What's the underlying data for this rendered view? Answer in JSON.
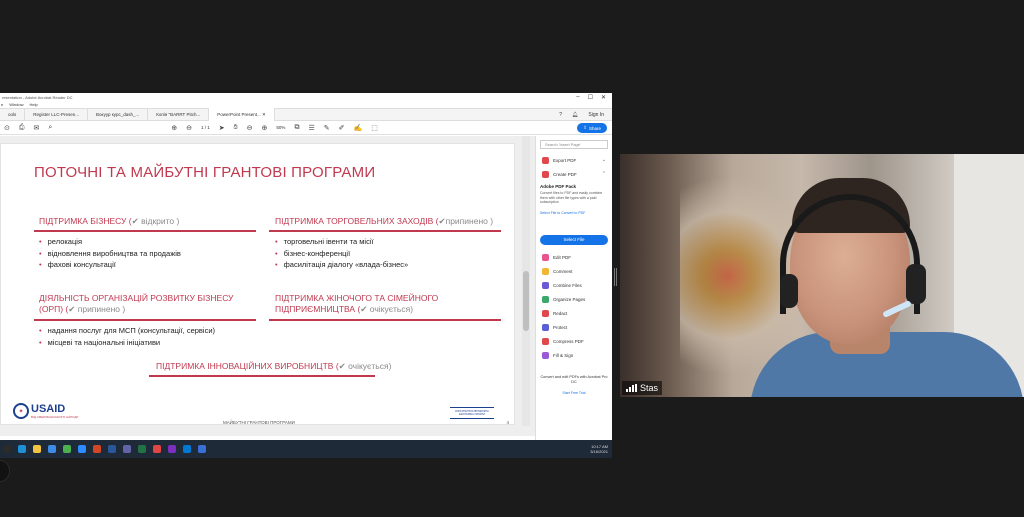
{
  "window": {
    "title": "resentation - Adobe Acrobat Reader DC",
    "menu": [
      "e",
      "Window",
      "Help"
    ]
  },
  "tabs": [
    {
      "label": "ools"
    },
    {
      "label": "Register LLC-Presen..."
    },
    {
      "label": "Вокуур курс_dash_..."
    },
    {
      "label": "Копія \"BARRT Pitch..."
    },
    {
      "label": "PowerPoint Present...",
      "active": true
    }
  ],
  "header": {
    "sign_in": "Sign In",
    "help_icon": "?",
    "bell_icon": "bell"
  },
  "toolbar": {
    "page_indicator": "1  /  1",
    "zoom": "50%",
    "share": "Share"
  },
  "slide": {
    "title": "ПОТОЧНІ ТА МАЙБУТНІ ГРАНТОВІ ПРОГРАМИ",
    "sec1": {
      "title": "ПІДТРИМКА БІЗНЕСУ (",
      "status": "✔ відкрито )",
      "items": [
        "релокація",
        "відновлення виробництва та продажів",
        "фахові консультації"
      ]
    },
    "sec2": {
      "title": "ПІДТРИМКА ТОРГОВЕЛЬНИХ ЗАХОДІВ (",
      "status": "✔припинено )",
      "items": [
        "торговельні івенти та місії",
        "бізнес-конференції",
        "фасилітація діалогу «влада-бізнес»"
      ]
    },
    "sec3": {
      "title1": "ДІЯЛЬНІСТЬ ОРГАНІЗАЦІЙ РОЗВИТКУ БІЗНЕСУ",
      "title2": "(ОРП) (",
      "status": "✔ припинено )",
      "items": [
        "надання послуг для МСП (консультації, сервіси)",
        "місцеві та національні ініціативи"
      ]
    },
    "sec4": {
      "title1": "ПІДТРИМКА ЖІНОЧОГО ТА СІМЕЙНОГО",
      "title2": "ПІДПРИЄМНИЦТВА (",
      "status": "✔ очікується)"
    },
    "sec5": {
      "title": "ПІДТРИМКА ІННОВАЦІЙНИХ ВИРОБНИЦТВ (",
      "status": "✔ очікується)"
    },
    "logo_text": "USAID",
    "logo_sub": "ВІД АМЕРИКАНСЬКОГО НАРОДУ",
    "footer": "МАЙБУТНІ ГРАНТОВІ ПРОГРАМИ",
    "page": "4",
    "right_logo": "КОНКУРЕНТОСПРОМОЖНА ЕКОНОМІКА УКРАЇНИ"
  },
  "pane": {
    "search_placeholder": "Search 'Insert Page'",
    "top_items": [
      {
        "label": "Export PDF",
        "color": "#e0484b",
        "chev": "⌄"
      },
      {
        "label": "Create PDF",
        "color": "#e0484b",
        "chev": "⌃"
      }
    ],
    "pack_title": "Adobe PDF Pack",
    "pack_desc": "Convert files to PDF and easily combine them with other file types with a paid subscription",
    "pack_link": "Select File to Convert to PDF",
    "select_btn": "Select File",
    "items": [
      {
        "label": "Edit PDF",
        "color": "#e9548f"
      },
      {
        "label": "Comment",
        "color": "#f2b632"
      },
      {
        "label": "Combine Files",
        "color": "#6a5ad6"
      },
      {
        "label": "Organize Pages",
        "color": "#3aa86b"
      },
      {
        "label": "Redact",
        "color": "#e0484b"
      },
      {
        "label": "Protect",
        "color": "#5b5fd6"
      },
      {
        "label": "Compress PDF",
        "color": "#e0484b"
      },
      {
        "label": "Fill & Sign",
        "color": "#9b59d6"
      }
    ],
    "convert_text": "Convert and edit PDFs with Acrobat Pro DC",
    "trial": "Start Free Trial"
  },
  "taskbar": {
    "time": "10:17 AM",
    "date": "3/16/2021"
  },
  "webcam": {
    "participant": "Stas"
  }
}
